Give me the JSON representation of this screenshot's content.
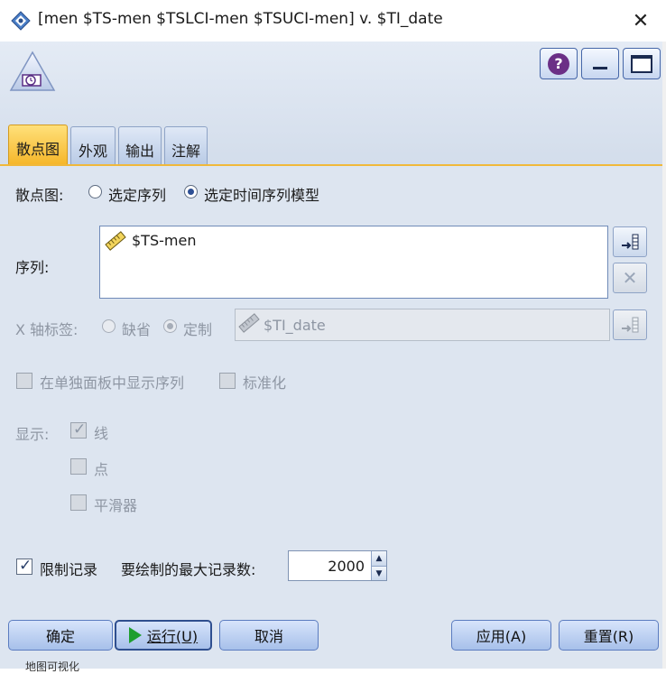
{
  "window": {
    "title": "[men $TS-men $TSLCI-men $TSUCI-men] v. $TI_date",
    "close_glyph": "✕"
  },
  "header": {
    "help_glyph": "?",
    "accent": "#4566a8"
  },
  "tabs": [
    {
      "label": "散点图",
      "active": true
    },
    {
      "label": "外观",
      "active": false
    },
    {
      "label": "输出",
      "active": false
    },
    {
      "label": "注解",
      "active": false
    }
  ],
  "form": {
    "scatter_label": "散点图:",
    "radio_series": "选定序列",
    "radio_model": "选定时间序列模型",
    "series_label": "序列:",
    "series_value": "$TS-men",
    "xaxis_label": "X 轴标签:",
    "xaxis_default": "缺省",
    "xaxis_custom": "定制",
    "xaxis_value": "$TI_date",
    "show_separate_panels": "在单独面板中显示序列",
    "normalize": "标准化",
    "display_label": "显示:",
    "display_line": "线",
    "display_points": "点",
    "display_smoother": "平滑器",
    "limit_records": "限制记录",
    "max_records_label": "要绘制的最大记录数:",
    "max_records_value": "2000"
  },
  "buttons": {
    "ok": "确定",
    "run": "运行(U)",
    "cancel": "取消",
    "apply": "应用(A)",
    "reset": "重置(R)"
  },
  "background_text": "地图可视化"
}
